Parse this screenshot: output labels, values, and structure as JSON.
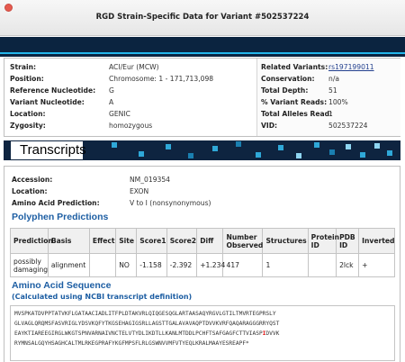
{
  "window": {
    "title": "RGD Strain-Specific Data for Variant #502537224"
  },
  "variant": {
    "left": [
      {
        "key": "Strain:",
        "value": "ACI/Eur (MCW)"
      },
      {
        "key": "Position:",
        "value": "Chromosome: 1 - 171,713,098"
      },
      {
        "key": "Reference Nucleotide:",
        "value": "G"
      },
      {
        "key": "Variant Nucleotide:",
        "value": "A"
      },
      {
        "key": "Location:",
        "value": "GENIC"
      },
      {
        "key": "Zygosity:",
        "value": "homozygous"
      }
    ],
    "right": [
      {
        "key": "Related Variants:",
        "value": "rs197199011",
        "link": true
      },
      {
        "key": "Conservation:",
        "value": "n/a"
      },
      {
        "key": "Total Depth:",
        "value": "51"
      },
      {
        "key": "% Variant Reads:",
        "value": "100%"
      },
      {
        "key": "Total Alleles Read:",
        "value": "1"
      },
      {
        "key": "VID:",
        "value": "502537224"
      }
    ]
  },
  "transcripts": {
    "header": "Transcripts",
    "fields": [
      {
        "key": "Accession:",
        "value": "NM_019354"
      },
      {
        "key": "Location:",
        "value": "EXON"
      },
      {
        "key": "Amino Acid Prediction:",
        "value": "V to I (nonsynonymous)"
      }
    ]
  },
  "polyphen": {
    "heading": "Polyphen Predictions",
    "columns": [
      "Prediction",
      "Basis",
      "Effect",
      "Site",
      "Score1",
      "Score2",
      "Diff",
      "Number Observed",
      "Structures",
      "Protein ID",
      "PDB ID",
      "Inverted"
    ],
    "rows": [
      [
        "possibly damaging",
        "alignment",
        "",
        "NO",
        "-1.158",
        "-2.392",
        "+1.234",
        "417",
        "1",
        "",
        "2lck",
        "+"
      ]
    ]
  },
  "amino_acid": {
    "heading": "Amino Acid Sequence",
    "subheading": "(Calculated using NCBI transcript definition)",
    "lines": [
      {
        "text": "MVSPKATDVPPTATVKFLGATAACIADLITFPLDTAKVRLQIQGESQGLARTAASAQYRGVLGTILTMVRTEGPRSLY"
      },
      {
        "text": "GLVAGLQRQMSFASVRIGLYDSVKQFYTKGSEHAGIGSRLLAGSTTGALAVAVAQPTDVVKVRFQAQARAGGGRRYQST"
      },
      {
        "text": "EAYKTIAREEGIRGLWKGTSPNVARNAIVNCTELVTYDLIKDTLLKANLMTDDLPCHFTSAFGAGFCTTVIASP",
        "highlight": "I",
        "after": "DVVK"
      },
      {
        "text": "RYMNSALGQYHSAGHCALTMLRKEGPRAFYKGFMPSFLRLGSWNVVMFVTYEQLKRALMAAYESREAPF*"
      }
    ]
  },
  "colors": {
    "dark_band": "#0b2440",
    "accent_cyan": "#23b6ea",
    "heading_blue": "#1d5ea3",
    "link": "#23408e",
    "highlight_red": "#e01515"
  }
}
